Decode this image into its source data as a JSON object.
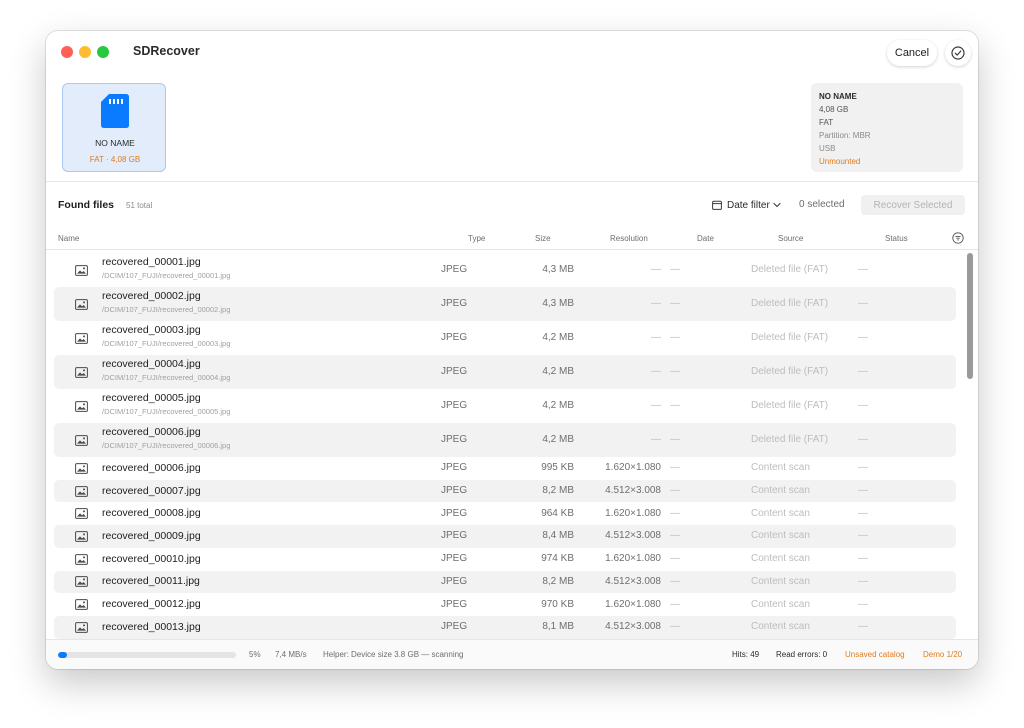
{
  "window": {
    "title": "SDRecover",
    "cancel_label": "Cancel"
  },
  "device_card": {
    "name": "NO NAME",
    "subtitle": "FAT · 4,08 GB",
    "icon": "sd-card-icon"
  },
  "device_info": {
    "name": "NO NAME",
    "size": "4,08 GB",
    "filesystem": "FAT",
    "partition": "Partition: MBR",
    "bus": "USB",
    "mount_status": "Unmounted"
  },
  "files_bar": {
    "title": "Found files",
    "count": "51 total",
    "date_filter_label": "Date filter",
    "selected": "0 selected",
    "recover_label": "Recover Selected"
  },
  "columns": {
    "name": "Name",
    "type": "Type",
    "size": "Size",
    "resolution": "Resolution",
    "date": "Date",
    "source": "Source",
    "status": "Status"
  },
  "files": [
    {
      "name": "recovered_00001.jpg",
      "path": "/DCIM/107_FUJI/recovered_00001.jpg",
      "type": "JPEG",
      "size": "4,3 MB",
      "resolution": "—",
      "date": "—",
      "source": "Deleted file (FAT)",
      "status": "—"
    },
    {
      "name": "recovered_00002.jpg",
      "path": "/DCIM/107_FUJI/recovered_00002.jpg",
      "type": "JPEG",
      "size": "4,3 MB",
      "resolution": "—",
      "date": "—",
      "source": "Deleted file (FAT)",
      "status": "—"
    },
    {
      "name": "recovered_00003.jpg",
      "path": "/DCIM/107_FUJI/recovered_00003.jpg",
      "type": "JPEG",
      "size": "4,2 MB",
      "resolution": "—",
      "date": "—",
      "source": "Deleted file (FAT)",
      "status": "—"
    },
    {
      "name": "recovered_00004.jpg",
      "path": "/DCIM/107_FUJI/recovered_00004.jpg",
      "type": "JPEG",
      "size": "4,2 MB",
      "resolution": "—",
      "date": "—",
      "source": "Deleted file (FAT)",
      "status": "—"
    },
    {
      "name": "recovered_00005.jpg",
      "path": "/DCIM/107_FUJI/recovered_00005.jpg",
      "type": "JPEG",
      "size": "4,2 MB",
      "resolution": "—",
      "date": "—",
      "source": "Deleted file (FAT)",
      "status": "—"
    },
    {
      "name": "recovered_00006.jpg",
      "path": "/DCIM/107_FUJI/recovered_00006.jpg",
      "type": "JPEG",
      "size": "4,2 MB",
      "resolution": "—",
      "date": "—",
      "source": "Deleted file (FAT)",
      "status": "—"
    },
    {
      "name": "recovered_00006.jpg",
      "path": "",
      "type": "JPEG",
      "size": "995 KB",
      "resolution": "1.620×1.080",
      "date": "—",
      "source": "Content scan",
      "status": "—"
    },
    {
      "name": "recovered_00007.jpg",
      "path": "",
      "type": "JPEG",
      "size": "8,2 MB",
      "resolution": "4.512×3.008",
      "date": "—",
      "source": "Content scan",
      "status": "—"
    },
    {
      "name": "recovered_00008.jpg",
      "path": "",
      "type": "JPEG",
      "size": "964 KB",
      "resolution": "1.620×1.080",
      "date": "—",
      "source": "Content scan",
      "status": "—"
    },
    {
      "name": "recovered_00009.jpg",
      "path": "",
      "type": "JPEG",
      "size": "8,4 MB",
      "resolution": "4.512×3.008",
      "date": "—",
      "source": "Content scan",
      "status": "—"
    },
    {
      "name": "recovered_00010.jpg",
      "path": "",
      "type": "JPEG",
      "size": "974 KB",
      "resolution": "1.620×1.080",
      "date": "—",
      "source": "Content scan",
      "status": "—"
    },
    {
      "name": "recovered_00011.jpg",
      "path": "",
      "type": "JPEG",
      "size": "8,2 MB",
      "resolution": "4.512×3.008",
      "date": "—",
      "source": "Content scan",
      "status": "—"
    },
    {
      "name": "recovered_00012.jpg",
      "path": "",
      "type": "JPEG",
      "size": "970 KB",
      "resolution": "1.620×1.080",
      "date": "—",
      "source": "Content scan",
      "status": "—"
    },
    {
      "name": "recovered_00013.jpg",
      "path": "",
      "type": "JPEG",
      "size": "8,1 MB",
      "resolution": "4.512×3.008",
      "date": "—",
      "source": "Content scan",
      "status": "—"
    }
  ],
  "status_bar": {
    "progress": 0.05,
    "percent": "5%",
    "speed": "7,4 MB/s",
    "helper": "Helper: Device size 3.8 GB — scanning",
    "hits": "Hits: 49",
    "read_errors": "Read errors: 0",
    "catalog": "Unsaved catalog",
    "demo": "Demo 1/20"
  },
  "colors": {
    "accent": "#0a7aff",
    "warning": "#e07b1c",
    "selection": "#e2ecfb"
  }
}
